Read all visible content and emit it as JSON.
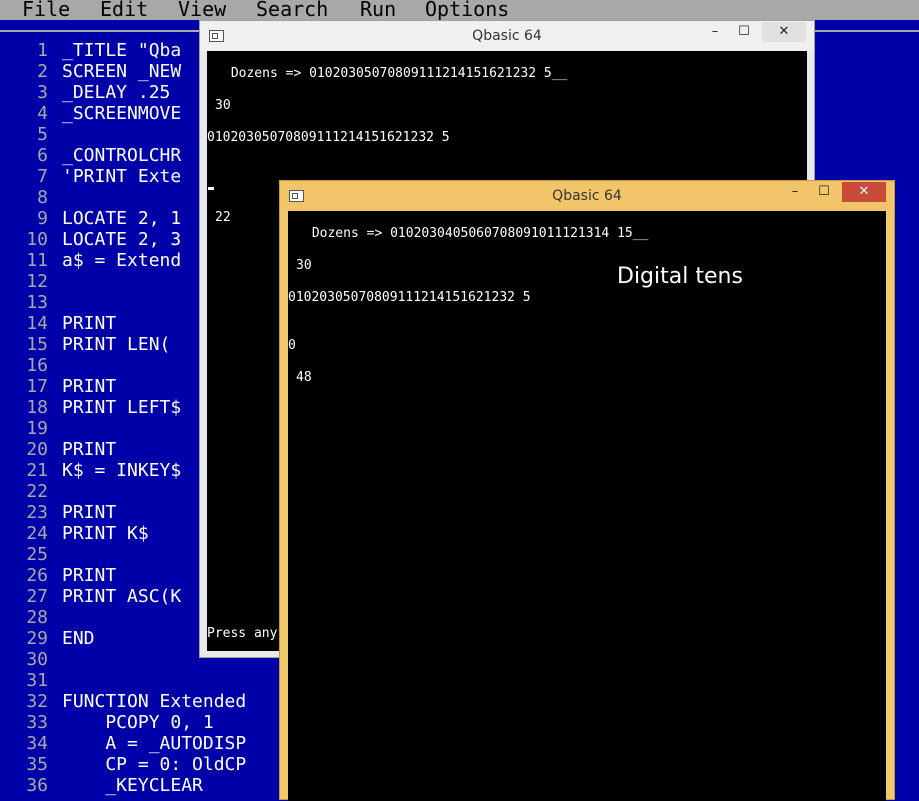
{
  "menu": [
    "File",
    "Edit",
    "View",
    "Search",
    "Run",
    "Options"
  ],
  "editor": {
    "lines": [
      {
        "n": "1",
        "t": "_TITLE \"Qba"
      },
      {
        "n": "2",
        "t": "SCREEN _NEW"
      },
      {
        "n": "3",
        "t": "_DELAY .25"
      },
      {
        "n": "4",
        "t": "_SCREENMOVE"
      },
      {
        "n": "5",
        "t": ""
      },
      {
        "n": "6",
        "t": "_CONTROLCHR"
      },
      {
        "n": "7",
        "t": "'PRINT Exte"
      },
      {
        "n": "8",
        "t": ""
      },
      {
        "n": "9",
        "t": "LOCATE 2, 1"
      },
      {
        "n": "10",
        "t": "LOCATE 2, 3"
      },
      {
        "n": "11",
        "t": "a$ = Extend"
      },
      {
        "n": "12",
        "t": ""
      },
      {
        "n": "13",
        "t": ""
      },
      {
        "n": "14",
        "t": "PRINT"
      },
      {
        "n": "15",
        "t": "PRINT LEN("
      },
      {
        "n": "16",
        "t": ""
      },
      {
        "n": "17",
        "t": "PRINT"
      },
      {
        "n": "18",
        "t": "PRINT LEFT$"
      },
      {
        "n": "19",
        "t": ""
      },
      {
        "n": "20",
        "t": "PRINT"
      },
      {
        "n": "21",
        "t": "K$ = INKEY$"
      },
      {
        "n": "22",
        "t": ""
      },
      {
        "n": "23",
        "t": "PRINT"
      },
      {
        "n": "24",
        "t": "PRINT K$"
      },
      {
        "n": "25",
        "t": ""
      },
      {
        "n": "26",
        "t": "PRINT"
      },
      {
        "n": "27",
        "t": "PRINT ASC(K"
      },
      {
        "n": "28",
        "t": ""
      },
      {
        "n": "29",
        "t": "END"
      },
      {
        "n": "30",
        "t": ""
      },
      {
        "n": "31",
        "t": ""
      },
      {
        "n": "32",
        "t": "FUNCTION Extended"
      },
      {
        "n": "33",
        "t": "    PCOPY 0, 1"
      },
      {
        "n": "34",
        "t": "    A = _AUTODISP"
      },
      {
        "n": "35",
        "t": "    CP = 0: OldCP"
      },
      {
        "n": "36",
        "t": "    _KEYCLEAR"
      }
    ]
  },
  "window1": {
    "title": "Qbasic 64",
    "minimize": "–",
    "maximize": "☐",
    "close": "✕",
    "lines": [
      " Dozens => 01020305070809111214151621232 5__",
      "30",
      "01020305070809111214151621232 5",
      "22",
      "Press any"
    ]
  },
  "window2": {
    "title": "Qbasic 64",
    "minimize": "–",
    "maximize": "☐",
    "close": "✕",
    "caption": "Digital tens",
    "lines": [
      " Dozens => 0102030405060708091011121314 15__",
      "30",
      "01020305070809111214151621232 5",
      "0",
      "48"
    ]
  }
}
